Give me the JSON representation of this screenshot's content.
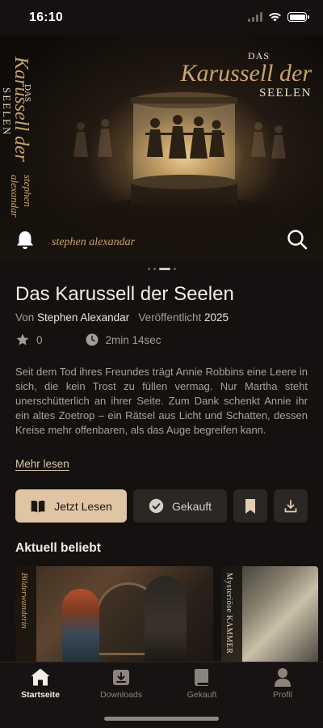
{
  "status_bar": {
    "time": "16:10"
  },
  "hero": {
    "cover": {
      "das": "DAS",
      "title_main": "Karussell der",
      "title_sub": "SEELEN",
      "author": "stephen alexandar"
    },
    "spine": {
      "das": "DAS",
      "title_main": "Karussell der",
      "title_sub": "SEELEN",
      "author": "stephen alexandar"
    },
    "icons": {
      "left": "bell-icon",
      "right": "search-icon"
    }
  },
  "pager": {
    "count": 4,
    "active": 2
  },
  "book": {
    "title": "Das Karussell der Seelen",
    "by_label": "Von",
    "author": "Stephen Alexandar",
    "published_label": "Veröffentlicht",
    "year": "2025",
    "rating": "0",
    "duration": "2min 14sec",
    "description": "Seit dem Tod ihres Freundes trägt Annie Robbins eine Leere in sich, die kein Trost zu füllen vermag. Nur Martha steht unerschütterlich an ihrer Seite. Zum Dank schenkt Annie ihr ein altes Zoetrop – ein Rätsel aus Licht und Schatten, dessen Kreise mehr offenbaren, als das Auge begreifen kann.",
    "more_label": "Mehr lesen"
  },
  "actions": {
    "read_label": "Jetzt Lesen",
    "bought_label": "Gekauft"
  },
  "popular": {
    "title": "Aktuell beliebt",
    "items": [
      {
        "spine_text": "Bilderwanderin"
      },
      {
        "spine_text": "Mysteriöse KAMMER"
      }
    ]
  },
  "tabs": [
    {
      "label": "Startseite",
      "icon": "home-icon",
      "active": true
    },
    {
      "label": "Downloads",
      "icon": "download-box-icon",
      "active": false
    },
    {
      "label": "Gekauft",
      "icon": "book-icon",
      "active": false
    },
    {
      "label": "Profil",
      "icon": "person-icon",
      "active": false
    }
  ],
  "colors": {
    "background": "#141110",
    "accent": "#dfc5a3",
    "secondary_button": "#2b2724",
    "muted_text": "#a59d95"
  }
}
